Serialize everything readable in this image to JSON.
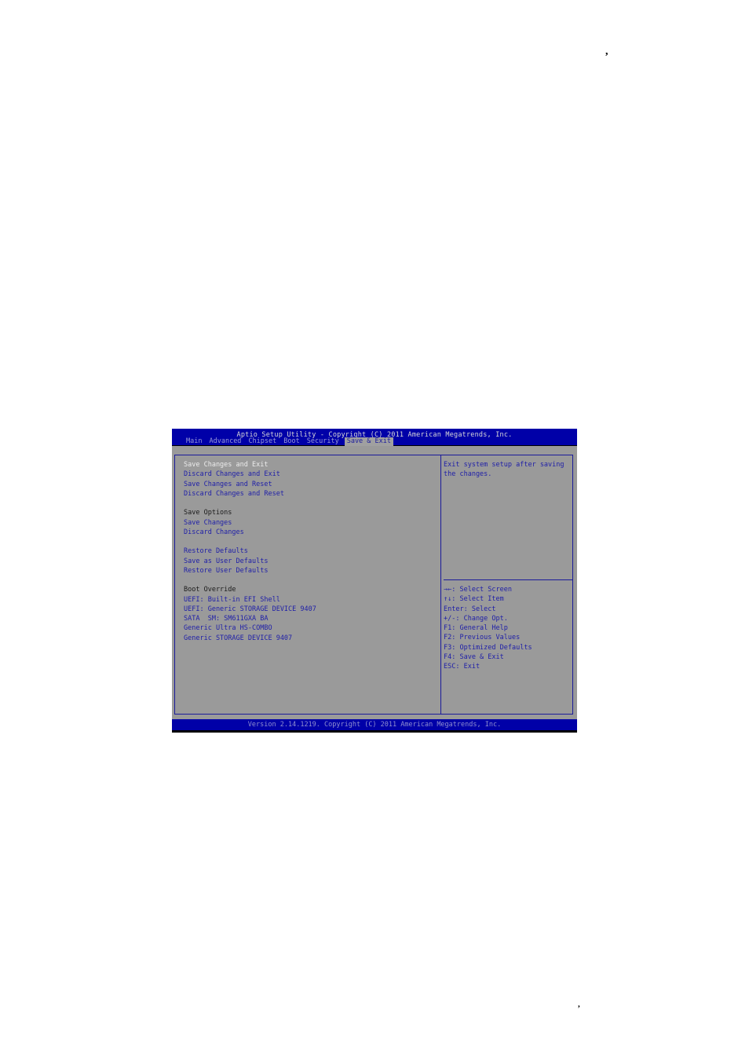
{
  "page_marks": {
    "top_comma": ",",
    "bottom_comma": ","
  },
  "bios": {
    "title": "Aptio Setup Utility - Copyright (C) 2011 American Megatrends, Inc.",
    "tabs": [
      {
        "label": "Main",
        "active": false
      },
      {
        "label": "Advanced",
        "active": false
      },
      {
        "label": "Chipset",
        "active": false
      },
      {
        "label": "Boot",
        "active": false
      },
      {
        "label": "Security",
        "active": false
      },
      {
        "label": "Save & Exit",
        "active": true
      }
    ],
    "menu": {
      "save_changes_and_exit": "Save Changes and Exit",
      "discard_changes_and_exit": "Discard Changes and Exit",
      "save_changes_and_reset": "Save Changes and Reset",
      "discard_changes_and_reset": "Discard Changes and Reset",
      "save_options_header": "Save Options",
      "save_changes": "Save Changes",
      "discard_changes": "Discard Changes",
      "restore_defaults": "Restore Defaults",
      "save_as_user_defaults": "Save as User Defaults",
      "restore_user_defaults": "Restore User Defaults",
      "boot_override_header": "Boot Override",
      "boot_devices": [
        "UEFI: Built-in EFI Shell",
        "UEFI: Generic STORAGE DEVICE 9407",
        "SATA  SM: SM611GXA BA",
        "Generic Ultra HS-COMBO",
        "Generic STORAGE DEVICE 9407"
      ],
      "selected_item": "Save Changes and Exit"
    },
    "help_text": "Exit system setup after saving the changes.",
    "key_help": [
      "→←: Select Screen",
      "↑↓: Select Item",
      "Enter: Select",
      "+/-: Change Opt.",
      "F1: General Help",
      "F2: Previous Values",
      "F3: Optimized Defaults",
      "F4: Save & Exit",
      "ESC: Exit"
    ],
    "footer": "Version 2.14.1219. Copyright (C) 2011 American Megatrends, Inc.",
    "colors": {
      "title_bar": "#0000a8",
      "panel_bg": "#9a9a9a",
      "item_text": "#2020a8",
      "selected_text": "#ececec",
      "header_text": "#1a1a1a"
    }
  }
}
